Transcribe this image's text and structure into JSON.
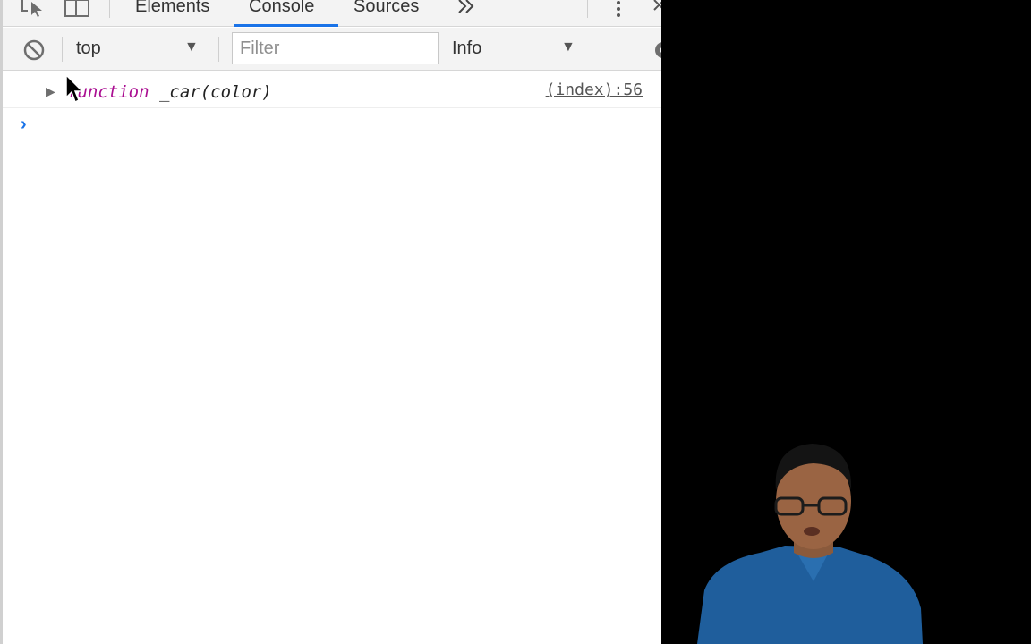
{
  "tabs": [
    {
      "label": "Elements",
      "active": false
    },
    {
      "label": "Console",
      "active": true
    },
    {
      "label": "Sources",
      "active": false
    }
  ],
  "tabbar": {
    "overflow_icon": "double-chevron-right-icon",
    "menu_icon": "vertical-dots-icon",
    "close_icon": "close-icon"
  },
  "toolbar": {
    "clear_icon": "clear-console-icon",
    "context": "top",
    "filter_placeholder": "Filter",
    "level": "Info",
    "settings_icon": "gear-icon"
  },
  "console": {
    "messages": [
      {
        "keyword": "function",
        "text": " _car(color)",
        "source": "(index):56"
      }
    ],
    "prompt_symbol": "›"
  },
  "colors": {
    "accent": "#1a73e8",
    "keyword": "#aa0d91",
    "toolbar_bg": "#f3f3f3",
    "webcam_bg": "#000000"
  }
}
